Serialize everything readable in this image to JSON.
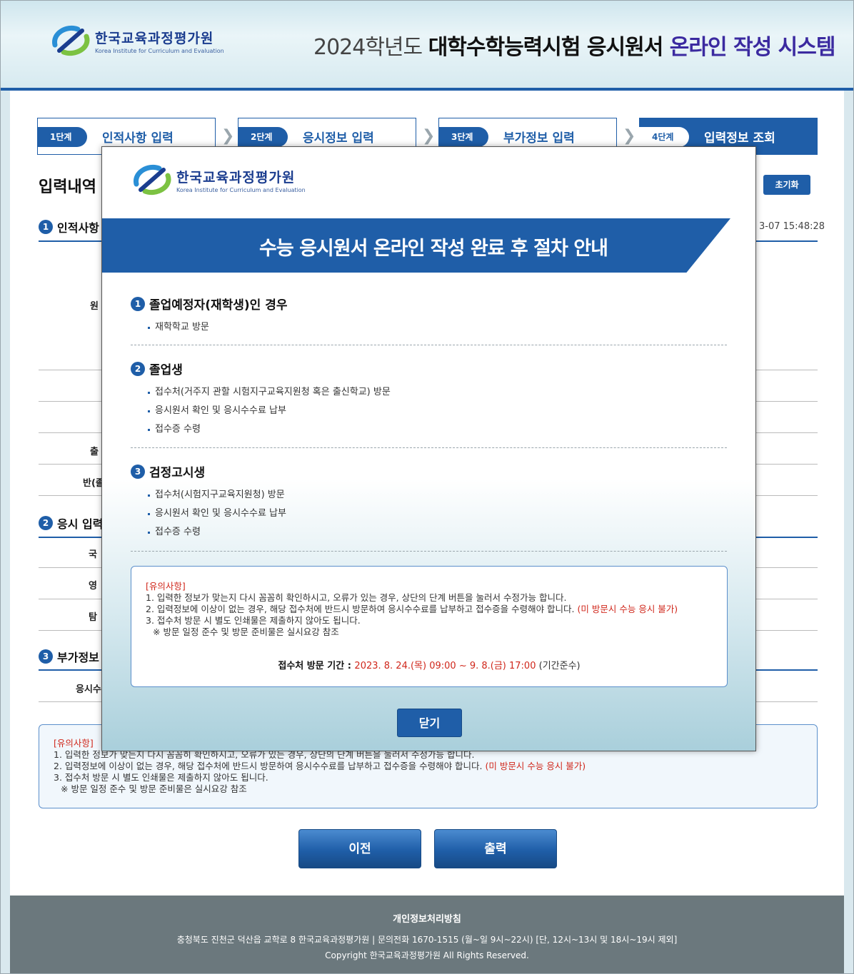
{
  "header": {
    "logo_ko": "한국교육과정평가원",
    "logo_en": "Korea Institute for Curriculum and Evaluation",
    "title_pre": "2024학년도 ",
    "title_bold": "대학수학능력시험 응시원서 ",
    "title_accent": "온라인 작성 시스템"
  },
  "steps": [
    {
      "badge": "1단계",
      "label": "인적사항 입력"
    },
    {
      "badge": "2단계",
      "label": "응시정보 입력"
    },
    {
      "badge": "3단계",
      "label": "부가정보 입력"
    },
    {
      "badge": "4단계",
      "label": "입력정보 조회"
    }
  ],
  "page": {
    "title": "입력내역",
    "reset_button": "초기화",
    "timestamp": "3-07 15:48:28",
    "sec1": {
      "num": "1",
      "title": "인적사항"
    },
    "sec2": {
      "num": "2",
      "title": "응시 입력"
    },
    "sec3": {
      "num": "3",
      "title": "부가정보"
    },
    "row_labels": [
      "원",
      "출",
      "반(졸",
      "국",
      "영",
      "탐",
      "응시수"
    ],
    "notice": {
      "head": "[유의사항]",
      "l1": "1. 입력한 정보가 맞는지 다시 꼼꼼히 확인하시고, 오류가 있는 경우, 상단의 단계 버튼을 눌러서 수정가능 합니다.",
      "l2": "2. 입력정보에 이상이 없는 경우, 해당 접수처에 반드시 방문하여 응시수수료를 납부하고 접수증을 수령해야 합니다. ",
      "l2_red": "(미 방문시 수능 응시 불가)",
      "l3": "3. 접수처 방문 시 별도 인쇄물은 제출하지 않아도 됩니다.",
      "l4": "※ 방문 일정 준수 및 방문 준비물은 실시요강 참조"
    },
    "prev_button": "이전",
    "print_button": "출력"
  },
  "footer": {
    "privacy": "개인정보처리방침",
    "address": "충청북도 진천군 덕산읍 교학로 8 한국교육과정평가원   |   문의전화 1670-1515 (월~일 9시~22시) [단, 12시~13시 및 18시~19시 제외]",
    "copyright": "Copyright 한국교육과정평가원 All Rights Reserved."
  },
  "modal": {
    "logo_ko": "한국교육과정평가원",
    "logo_en": "Korea Institute for Curriculum and Evaluation",
    "banner": "수능 응시원서 온라인 작성 완료 후 절차 안내",
    "sections": [
      {
        "num": "1",
        "title": "졸업예정자(재학생)인 경우",
        "items": [
          "재학학교 방문"
        ]
      },
      {
        "num": "2",
        "title": "졸업생",
        "items": [
          "접수처(거주지 관할 시험지구교육지원청 혹은 출신학교) 방문",
          "응시원서 확인 및 응시수수료 납부",
          "접수증 수령"
        ]
      },
      {
        "num": "3",
        "title": "검정고시생",
        "items": [
          "접수처(시험지구교육지원청) 방문",
          "응시원서 확인 및 응시수수료 납부",
          "접수증 수령"
        ]
      }
    ],
    "notice": {
      "head": "[유의사항]",
      "l1": "1. 입력한 정보가 맞는지 다시 꼼꼼히 확인하시고, 오류가 있는 경우, 상단의 단계 버튼을 눌러서 수정가능 합니다.",
      "l2": "2. 입력정보에 이상이 없는 경우, 해당 접수처에 반드시 방문하여 응시수수료를 납부하고 접수증을 수령해야 합니다. ",
      "l2_red": "(미 방문시 수능 응시 불가)",
      "l3": "3. 접수처 방문 시 별도 인쇄물은 제출하지 않아도 됩니다.",
      "l4": "※ 방문 일정 준수 및 방문 준비물은 실시요강 참조",
      "period_label": "접수처 방문 기간 : ",
      "period_value": "2023. 8. 24.(목) 09:00 ~ 9. 8.(금) 17:00",
      "period_note": " (기간준수)"
    },
    "close_button": "닫기"
  },
  "colors": {
    "primary": "#1f5ea8",
    "accent_purple": "#3b2aa0",
    "warning_red": "#d0271b",
    "footer_bg": "#6b787d"
  }
}
